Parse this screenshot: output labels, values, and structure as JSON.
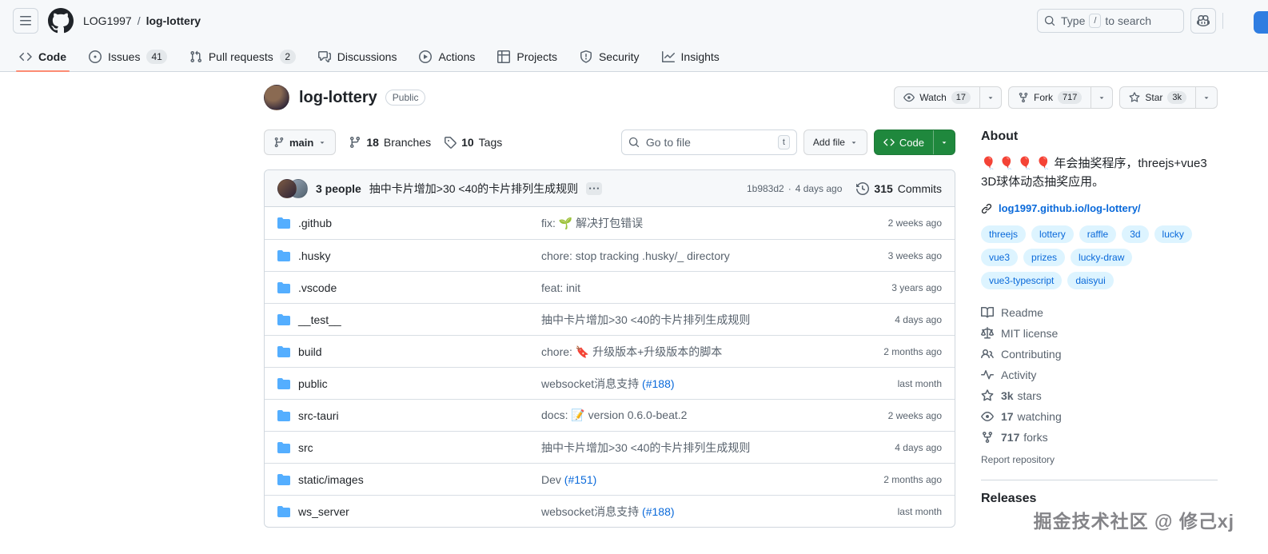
{
  "topbar": {
    "owner": "LOG1997",
    "separator": "/",
    "repo": "log-lottery",
    "search_prefix": "Type",
    "search_key": "/",
    "search_suffix": "to search"
  },
  "tabs": [
    {
      "label": "Code"
    },
    {
      "label": "Issues",
      "count": "41"
    },
    {
      "label": "Pull requests",
      "count": "2"
    },
    {
      "label": "Discussions"
    },
    {
      "label": "Actions"
    },
    {
      "label": "Projects"
    },
    {
      "label": "Security"
    },
    {
      "label": "Insights"
    }
  ],
  "repo": {
    "title": "log-lottery",
    "visibility": "Public",
    "watch": {
      "label": "Watch",
      "count": "17"
    },
    "fork": {
      "label": "Fork",
      "count": "717"
    },
    "star": {
      "label": "Star",
      "count": "3k"
    }
  },
  "toolbar": {
    "branch": "main",
    "branches_count": "18",
    "branches_label": "Branches",
    "tags_count": "10",
    "tags_label": "Tags",
    "goto_file": "Go to file",
    "goto_key": "t",
    "add_file": "Add file",
    "code": "Code"
  },
  "commit": {
    "authors": "3 people",
    "message": "抽中卡片增加>30 <40的卡片排列生成规则",
    "hash": "1b983d2",
    "separator": "·",
    "time": "4 days ago",
    "count": "315",
    "count_label": "Commits"
  },
  "files": [
    {
      "name": ".github",
      "message": "fix: 🌱 解决打包错误",
      "link": "",
      "age": "2 weeks ago"
    },
    {
      "name": ".husky",
      "message": "chore: stop tracking .husky/_ directory",
      "link": "",
      "age": "3 weeks ago"
    },
    {
      "name": ".vscode",
      "message": "feat: init",
      "link": "",
      "age": "3 years ago"
    },
    {
      "name": "__test__",
      "message": "抽中卡片增加>30 <40的卡片排列生成规则",
      "link": "",
      "age": "4 days ago"
    },
    {
      "name": "build",
      "message": "chore: 🔖 升级版本+升级版本的脚本",
      "link": "",
      "age": "2 months ago"
    },
    {
      "name": "public",
      "message": "websocket消息支持 ",
      "link": "(#188)",
      "age": "last month"
    },
    {
      "name": "src-tauri",
      "message": "docs: 📝 version 0.6.0-beat.2",
      "link": "",
      "age": "2 weeks ago"
    },
    {
      "name": "src",
      "message": "抽中卡片增加>30 <40的卡片排列生成规则",
      "link": "",
      "age": "4 days ago"
    },
    {
      "name": "static/images",
      "message": "Dev ",
      "link": "(#151)",
      "age": "2 months ago"
    },
    {
      "name": "ws_server",
      "message": "websocket消息支持 ",
      "link": "(#188)",
      "age": "last month"
    }
  ],
  "about": {
    "heading": "About",
    "description": "🎈 🎈 🎈 🎈 年会抽奖程序，threejs+vue3 3D球体动态抽奖应用。",
    "website": "log1997.github.io/log-lottery/",
    "topics": [
      "threejs",
      "lottery",
      "raffle",
      "3d",
      "lucky",
      "vue3",
      "prizes",
      "lucky-draw",
      "vue3-typescript",
      "daisyui"
    ],
    "readme": "Readme",
    "license": "MIT license",
    "contributing": "Contributing",
    "activity": "Activity",
    "stars_count": "3k",
    "stars_label": "stars",
    "watching_count": "17",
    "watching_label": "watching",
    "forks_count": "717",
    "forks_label": "forks",
    "report": "Report repository",
    "releases": "Releases"
  },
  "watermark": "掘金技术社区 @ 修己xj",
  "colors": {
    "accent": "#0969da",
    "button_green": "#1f883d",
    "tab_underline": "#fd8c73",
    "folder_icon": "#54aeff",
    "topic_bg": "#ddf4ff",
    "header_bg": "#f6f8fa"
  }
}
